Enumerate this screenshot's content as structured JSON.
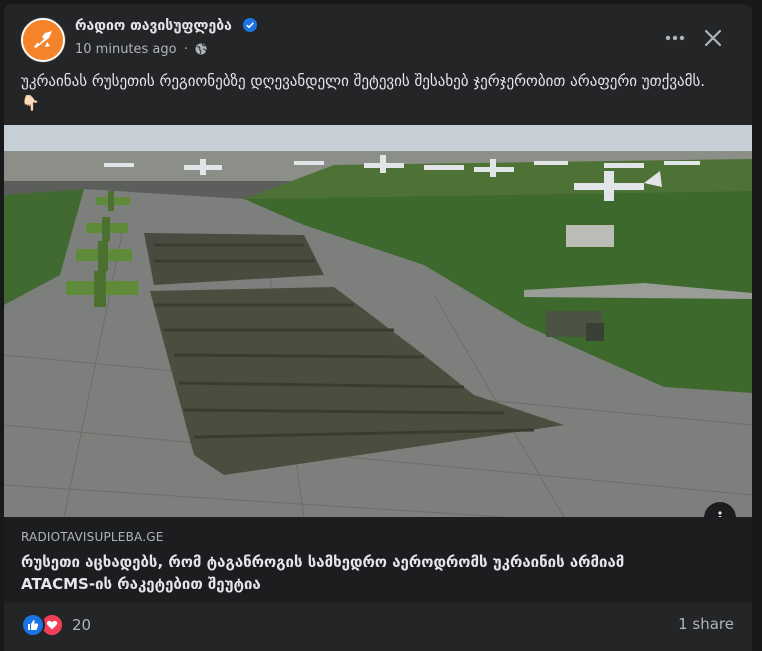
{
  "post": {
    "page_name": "რადიო თავისუფლება",
    "verified_icon": "verified-badge-icon",
    "timestamp": "10 minutes ago",
    "separator": "·",
    "privacy_icon": "globe-icon",
    "caption": "უკრაინას რუსეთის რეგიონებზე დღევანდელი შეტევის შესახებ ჯერჯერობით არაფერი უთქვამს. 👇🏻",
    "more_icon": "more-options-icon",
    "close_icon": "close-icon"
  },
  "photo": {
    "description_icon": "info-icon"
  },
  "link": {
    "domain": "RADIOTAVISUPLEBA.GE",
    "title": "რუსეთი აცხადებს, რომ ტაგანროგის სამხედრო აეროდრომს უკრაინის არმიამ ATACMS-ის რაკეტებით შეუტია"
  },
  "footer": {
    "reaction_count": "20",
    "shares": "1 share"
  },
  "colors": {
    "background": "#242526",
    "accent": "#1b74e4",
    "love": "#f33e58",
    "avatar_brand": "#f4842b",
    "text_primary": "#e4e6eb",
    "text_secondary": "#b0b3b8"
  }
}
